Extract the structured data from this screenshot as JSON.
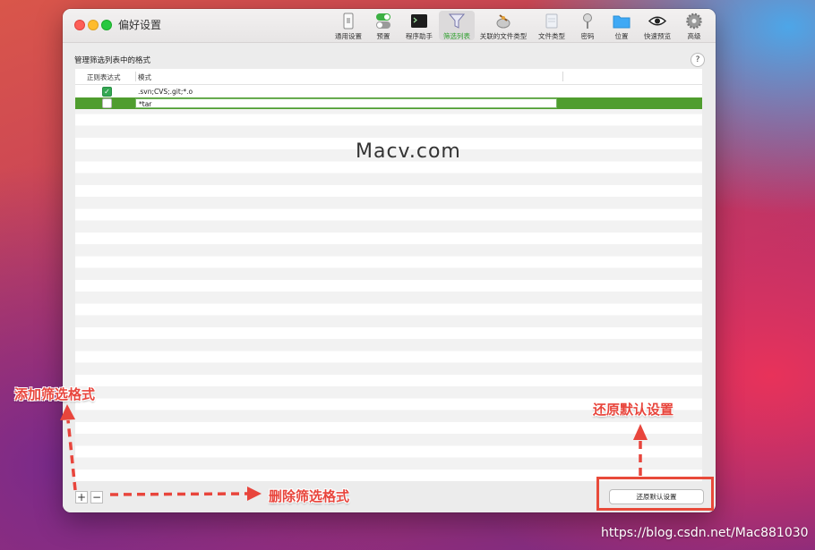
{
  "window": {
    "title": "偏好设置"
  },
  "toolbar": [
    {
      "label": "通用设置",
      "icon": "phone-switch-icon"
    },
    {
      "label": "预置",
      "icon": "toggles-icon"
    },
    {
      "label": "程序助手",
      "icon": "terminal-icon"
    },
    {
      "label": "筛选列表",
      "icon": "filter-icon",
      "active": true
    },
    {
      "label": "关联的文件类型",
      "icon": "app-script-icon"
    },
    {
      "label": "文件类型",
      "icon": "file-types-icon"
    },
    {
      "label": "密码",
      "icon": "key-icon"
    },
    {
      "label": "位置",
      "icon": "folder-icon"
    },
    {
      "label": "快速预览",
      "icon": "eye-icon"
    },
    {
      "label": "高级",
      "icon": "gear-icon"
    }
  ],
  "section": {
    "title": "管理筛选列表中的格式",
    "help": "?"
  },
  "table": {
    "columns": [
      "正则表达式",
      "模式"
    ],
    "rows": [
      {
        "regex": true,
        "pattern": ".svn;CVS;.git;*.o"
      },
      {
        "regex": false,
        "pattern": "*tar",
        "selected": true,
        "editing": true
      }
    ]
  },
  "bottom": {
    "add": "+",
    "remove": "−",
    "restore_label": "还原默认设置"
  },
  "annotations": {
    "add_format": "添加筛选格式",
    "delete_format": "删除筛选格式",
    "restore_default": "还原默认设置",
    "watermark": "Macv.com",
    "source_url": "https://blog.csdn.net/Mac881030"
  },
  "colors": {
    "accent_green": "#4f9d2e",
    "annotation_red": "#e8453c"
  }
}
